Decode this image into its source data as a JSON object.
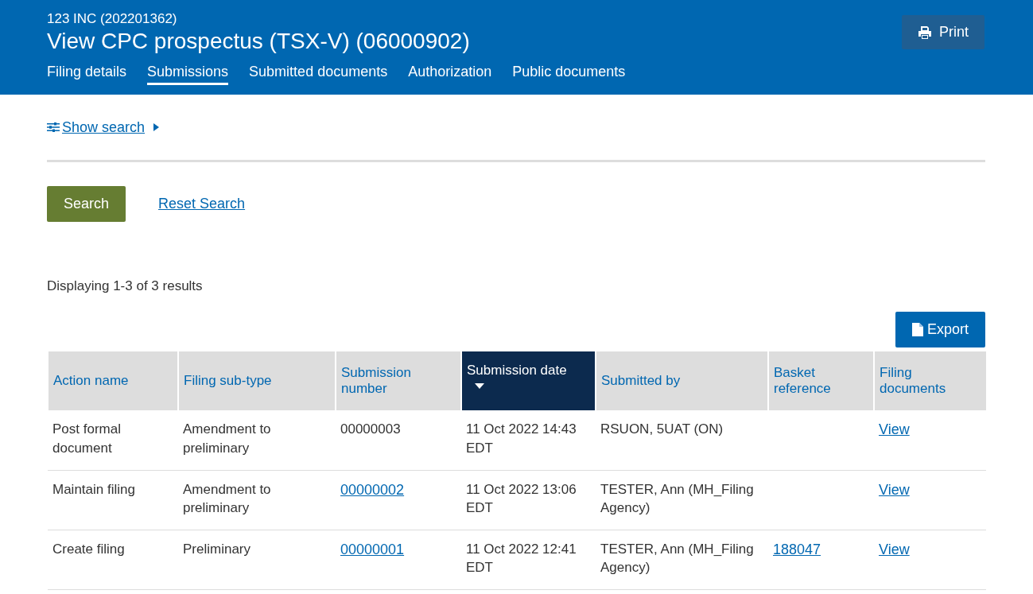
{
  "header": {
    "company": "123 INC (202201362)",
    "title": "View CPC prospectus (TSX-V) (06000902)",
    "print_button": "Print"
  },
  "tabs": [
    {
      "label": "Filing details",
      "selected": false
    },
    {
      "label": "Submissions",
      "selected": true
    },
    {
      "label": "Submitted documents",
      "selected": false
    },
    {
      "label": "Authorization",
      "selected": false
    },
    {
      "label": "Public documents",
      "selected": false
    }
  ],
  "show_search": {
    "label": "Show search",
    "expanded": false
  },
  "search_button": "Search",
  "reset_link": "Reset Search",
  "results_summary": "Displaying 1-3 of 3 results",
  "export_button": "Export",
  "table": {
    "columns": [
      {
        "label": "Action name",
        "sorted": false
      },
      {
        "label": "Filing sub-type",
        "sorted": false
      },
      {
        "label": "Submission number",
        "sorted": false
      },
      {
        "label": "Submission date",
        "sorted": true
      },
      {
        "label": "Submitted by",
        "sorted": false
      },
      {
        "label": "Basket reference",
        "sorted": false
      },
      {
        "label": "Filing documents",
        "sorted": false
      }
    ],
    "rows": [
      [
        {
          "text": "Post formal document",
          "kind": "text"
        },
        {
          "text": "Amendment to preliminary",
          "kind": "text"
        },
        {
          "text": "00000003",
          "kind": "text"
        },
        {
          "text": "11 Oct 2022 14:43 EDT",
          "kind": "text"
        },
        {
          "text": "RSUON, 5UAT (ON)",
          "kind": "text"
        },
        {
          "text": "",
          "kind": "text"
        },
        {
          "text": "View",
          "kind": "link"
        }
      ],
      [
        {
          "text": "Maintain filing",
          "kind": "text"
        },
        {
          "text": "Amendment to preliminary",
          "kind": "text"
        },
        {
          "text": "00000002",
          "kind": "link"
        },
        {
          "text": "11 Oct 2022 13:06 EDT",
          "kind": "text"
        },
        {
          "text": "TESTER, Ann (MH_Filing Agency)",
          "kind": "text"
        },
        {
          "text": "",
          "kind": "text"
        },
        {
          "text": "View",
          "kind": "link"
        }
      ],
      [
        {
          "text": "Create filing",
          "kind": "text"
        },
        {
          "text": "Preliminary",
          "kind": "text"
        },
        {
          "text": "00000001",
          "kind": "link"
        },
        {
          "text": "11 Oct 2022 12:41 EDT",
          "kind": "text"
        },
        {
          "text": "TESTER, Ann (MH_Filing Agency)",
          "kind": "text"
        },
        {
          "text": "188047",
          "kind": "link"
        },
        {
          "text": "View",
          "kind": "link"
        }
      ]
    ]
  }
}
